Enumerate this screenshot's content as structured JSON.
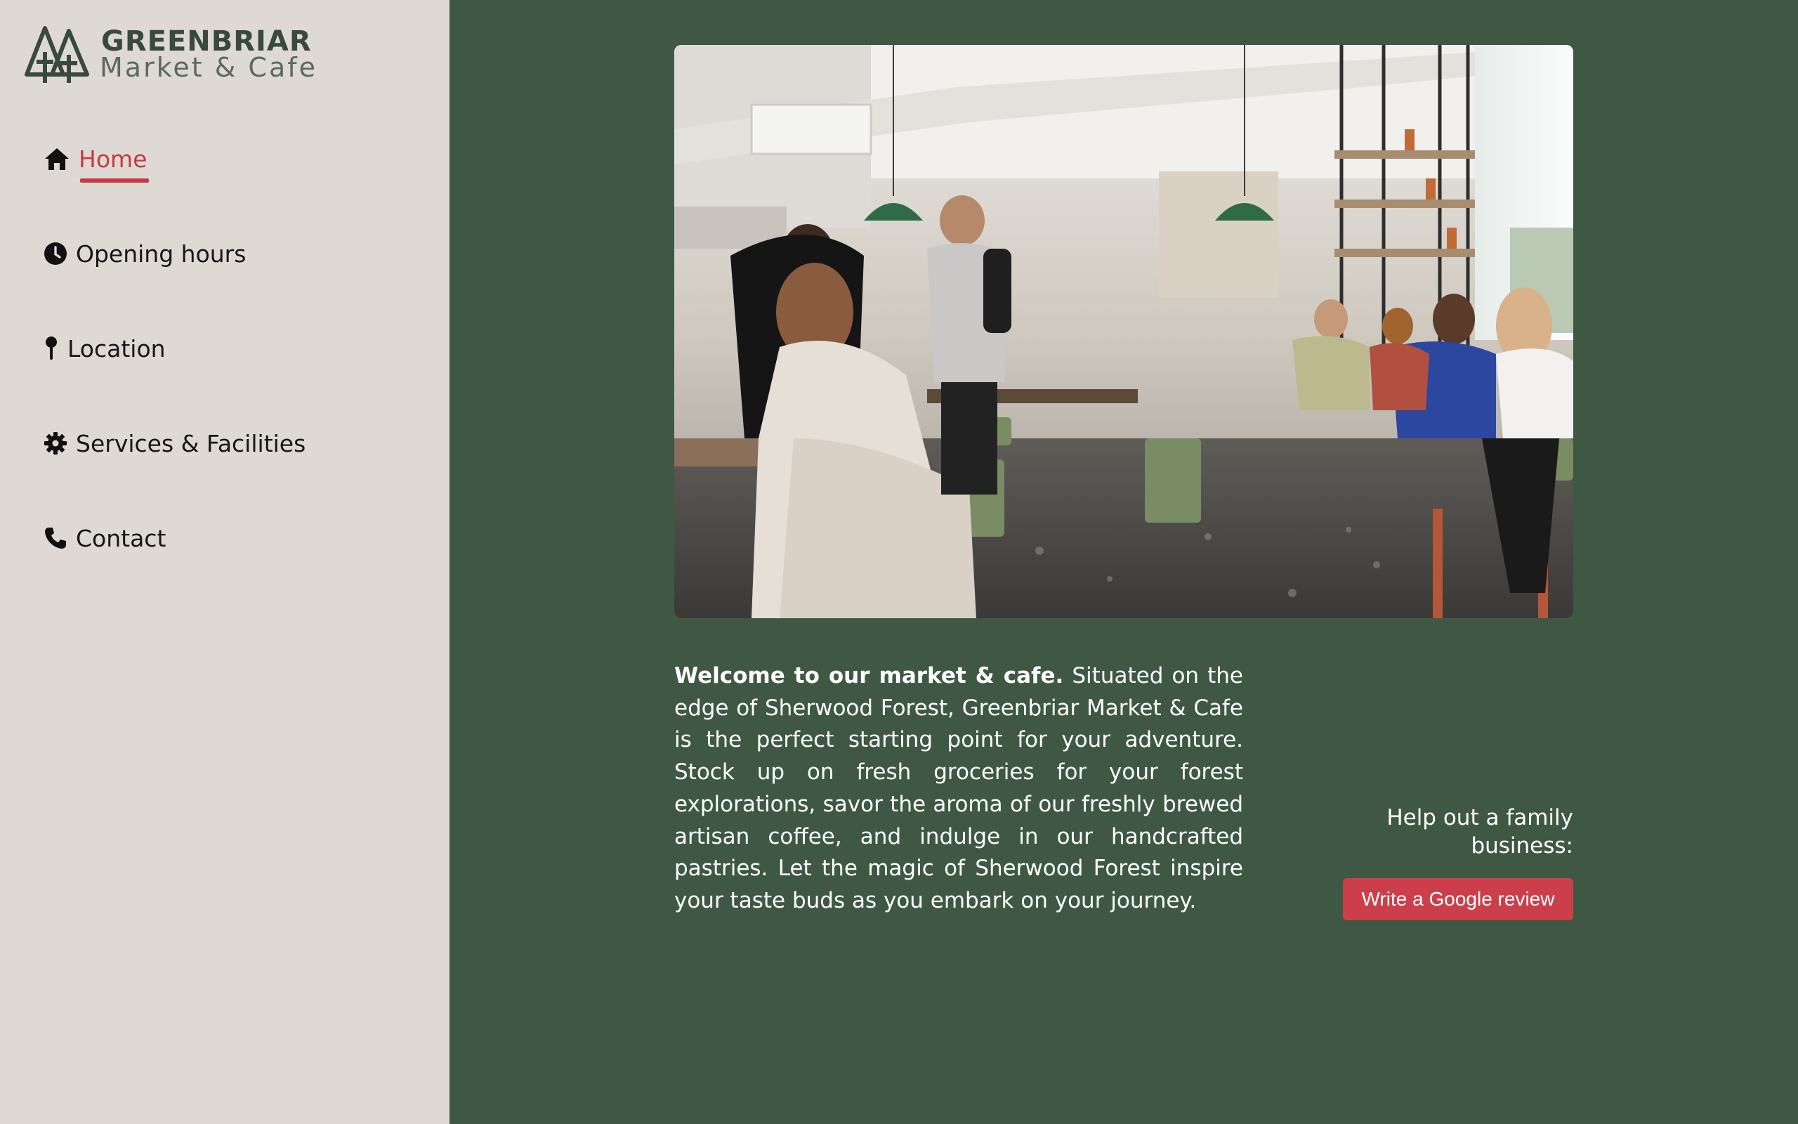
{
  "brand": {
    "name": "GREENBRIAR",
    "tagline": "Market & Cafe"
  },
  "nav": {
    "items": [
      {
        "label": "Home",
        "icon": "home-icon",
        "active": true
      },
      {
        "label": "Opening hours",
        "icon": "clock-icon"
      },
      {
        "label": "Location",
        "icon": "map-pin-icon"
      },
      {
        "label": "Services & Facilities",
        "icon": "gear-icon"
      },
      {
        "label": "Contact",
        "icon": "phone-icon"
      }
    ]
  },
  "intro": {
    "lead": "Welcome to our market & cafe.",
    "body": " Situated on the edge of Sherwood Forest, Greenbriar Market & Cafe is the perfect starting point for your adventure. Stock up on fresh groceries for your forest explorations, savor the aroma of our freshly brewed artisan coffee, and indulge in our handcrafted pastries. Let the magic of Sherwood Forest inspire your taste buds as you embark on your journey."
  },
  "review": {
    "prompt": "Help out a family business:",
    "button": "Write a Google review"
  },
  "colors": {
    "sidebar_bg": "#dedad3",
    "main_bg": "#3f5844",
    "accent": "#c73a45",
    "button_bg": "#cc3f4a"
  }
}
